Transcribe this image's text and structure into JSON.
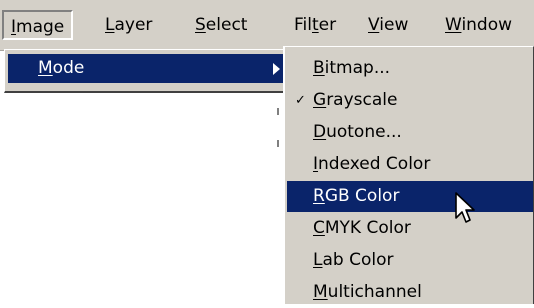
{
  "menubar": {
    "items": [
      {
        "label": "Image",
        "mnemonic": "I",
        "rest": "mage"
      },
      {
        "label": "Layer",
        "mnemonic": "L",
        "rest": "ayer"
      },
      {
        "label": "Select",
        "mnemonic": "S",
        "rest": "elect"
      },
      {
        "label": "Filter",
        "pre": "Fil",
        "mnemonic": "t",
        "rest": "er"
      },
      {
        "label": "View",
        "mnemonic": "V",
        "rest": "iew"
      },
      {
        "label": "Window",
        "mnemonic": "W",
        "rest": "indow"
      }
    ]
  },
  "image_menu": {
    "mode": {
      "mnemonic": "M",
      "rest": "ode"
    }
  },
  "mode_submenu": {
    "items": [
      {
        "mnemonic": "B",
        "rest": "itmap..."
      },
      {
        "mnemonic": "G",
        "rest": "rayscale",
        "checked": "✓"
      },
      {
        "mnemonic": "D",
        "rest": "uotone..."
      },
      {
        "mnemonic": "I",
        "rest": "ndexed Color"
      },
      {
        "mnemonic": "R",
        "rest": "GB Color"
      },
      {
        "mnemonic": "C",
        "rest": "MYK Color"
      },
      {
        "mnemonic": "L",
        "rest": "ab Color"
      },
      {
        "mnemonic": "M",
        "rest": "ultichannel"
      }
    ]
  },
  "colors": {
    "menu_bg": "#d4d0c8",
    "highlight": "#0a246a",
    "highlight_text": "#ffffff"
  },
  "icons": {
    "cursor": "arrow-pointer-icon",
    "submenu": "submenu-arrow-icon",
    "check": "checkmark-icon"
  }
}
